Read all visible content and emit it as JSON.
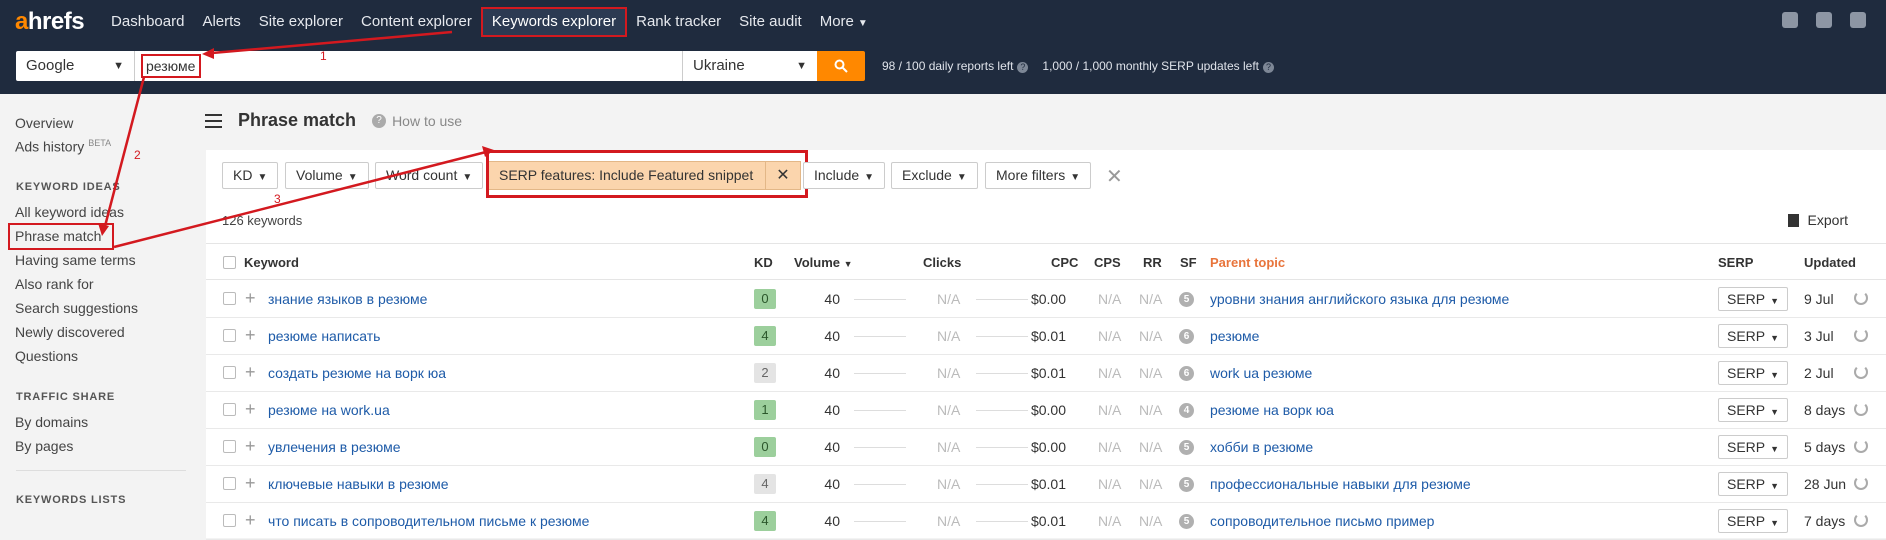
{
  "brand": {
    "logo_a": "a",
    "logo_rest": "hrefs"
  },
  "nav": {
    "items": [
      {
        "label": "Dashboard"
      },
      {
        "label": "Alerts"
      },
      {
        "label": "Site explorer"
      },
      {
        "label": "Content explorer"
      },
      {
        "label": "Keywords explorer",
        "active": true
      },
      {
        "label": "Rank tracker"
      },
      {
        "label": "Site audit"
      },
      {
        "label": "More"
      }
    ]
  },
  "search": {
    "engine": "Google",
    "query": "резюме",
    "country": "Ukraine",
    "reports_left": "98 / 100 daily reports left",
    "serp_updates_left": "1,000 / 1,000 monthly SERP updates left"
  },
  "sidebar": {
    "overview": "Overview",
    "ads_history": "Ads history",
    "beta_badge": "BETA",
    "keyword_ideas_heading": "KEYWORD IDEAS",
    "keyword_ideas": [
      "All keyword ideas",
      "Phrase match",
      "Having same terms",
      "Also rank for",
      "Search suggestions",
      "Newly discovered",
      "Questions"
    ],
    "traffic_share_heading": "TRAFFIC SHARE",
    "traffic_share": [
      "By domains",
      "By pages"
    ],
    "keywords_lists_heading": "KEYWORDS LISTS"
  },
  "page": {
    "title": "Phrase match",
    "how_to": "How to use"
  },
  "filters": {
    "kd": "KD",
    "volume": "Volume",
    "word_count": "Word count",
    "serp_features": "SERP features: Include Featured snippet",
    "include": "Include",
    "exclude": "Exclude",
    "more": "More filters"
  },
  "results": {
    "count": "126 keywords",
    "export": "Export"
  },
  "columns": {
    "keyword": "Keyword",
    "kd": "KD",
    "volume": "Volume",
    "clicks": "Clicks",
    "cpc": "CPC",
    "cps": "CPS",
    "rr": "RR",
    "sf": "SF",
    "parent_topic": "Parent topic",
    "serp": "SERP",
    "updated": "Updated"
  },
  "rows": [
    {
      "keyword": "знание языков в резюме",
      "kd": "0",
      "kd_color": "green",
      "volume": "40",
      "clicks": "N/A",
      "cpc": "$0.00",
      "cps": "N/A",
      "rr": "N/A",
      "sf": "5",
      "parent": "уровни знания английского языка для резюме",
      "serp": "SERP",
      "updated": "9 Jul"
    },
    {
      "keyword": "резюме написать",
      "kd": "4",
      "kd_color": "green",
      "volume": "40",
      "clicks": "N/A",
      "cpc": "$0.01",
      "cps": "N/A",
      "rr": "N/A",
      "sf": "6",
      "parent": "резюме",
      "serp": "SERP",
      "updated": "3 Jul"
    },
    {
      "keyword": "создать резюме на ворк юа",
      "kd": "2",
      "kd_color": "grey",
      "volume": "40",
      "clicks": "N/A",
      "cpc": "$0.01",
      "cps": "N/A",
      "rr": "N/A",
      "sf": "6",
      "parent": "work ua резюме",
      "serp": "SERP",
      "updated": "2 Jul"
    },
    {
      "keyword": "резюме на work.ua",
      "kd": "1",
      "kd_color": "green",
      "volume": "40",
      "clicks": "N/A",
      "cpc": "$0.00",
      "cps": "N/A",
      "rr": "N/A",
      "sf": "4",
      "parent": "резюме на ворк юа",
      "serp": "SERP",
      "updated": "8 days"
    },
    {
      "keyword": "увлечения в резюме",
      "kd": "0",
      "kd_color": "green",
      "volume": "40",
      "clicks": "N/A",
      "cpc": "$0.00",
      "cps": "N/A",
      "rr": "N/A",
      "sf": "5",
      "parent": "хобби в резюме",
      "serp": "SERP",
      "updated": "5 days"
    },
    {
      "keyword": "ключевые навыки в резюме",
      "kd": "4",
      "kd_color": "grey",
      "volume": "40",
      "clicks": "N/A",
      "cpc": "$0.01",
      "cps": "N/A",
      "rr": "N/A",
      "sf": "5",
      "parent": "профессиональные навыки для резюме",
      "serp": "SERP",
      "updated": "28 Jun"
    },
    {
      "keyword": "что писать в сопроводительном письме к резюме",
      "kd": "4",
      "kd_color": "green",
      "volume": "40",
      "clicks": "N/A",
      "cpc": "$0.01",
      "cps": "N/A",
      "rr": "N/A",
      "sf": "5",
      "parent": "сопроводительное письмо пример",
      "serp": "SERP",
      "updated": "7 days"
    }
  ],
  "annotations": {
    "step1": "1",
    "step2": "2",
    "step3": "3",
    "color": "#d3191f"
  },
  "colors": {
    "nav_bg": "#1f2b3e",
    "accent_orange": "#ff8800",
    "link_blue": "#1e5ba8",
    "parent_topic_header": "#e8743b",
    "kd_green": "#9ccf9c",
    "filter_active": "#fbd5ad"
  }
}
